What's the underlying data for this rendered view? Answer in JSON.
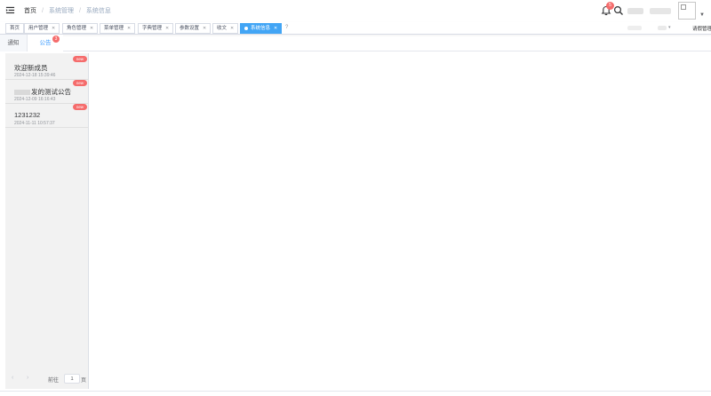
{
  "navbar": {
    "breadcrumb": [
      "首页",
      "系统管理",
      "系统信息"
    ],
    "notification_count": "5"
  },
  "tags": [
    {
      "label": "首页",
      "closable": false
    },
    {
      "label": "用户管理",
      "closable": true
    },
    {
      "label": "角色管理",
      "closable": true
    },
    {
      "label": "菜单管理",
      "closable": true
    },
    {
      "label": "字典管理",
      "closable": true
    },
    {
      "label": "参数设置",
      "closable": true
    },
    {
      "label": "收文",
      "closable": true
    },
    {
      "label": "系统信息",
      "closable": true,
      "active": true
    }
  ],
  "tags_extra": {
    "question": "?",
    "last_label": "请假管理"
  },
  "tabs": {
    "notice": "通知",
    "announcement": "公告",
    "announcement_badge": "3"
  },
  "announcements": [
    {
      "title": "欢迎新成员",
      "time": "2024-12-18 15:39:46",
      "badge": "new"
    },
    {
      "title": "发的测试公告",
      "time": "2024-12-09 16:16:43",
      "badge": "new"
    },
    {
      "title": "1231232",
      "time": "2024-11-11 10:57:37",
      "badge": "new"
    }
  ],
  "pagination": {
    "goto_label": "前往",
    "page_value": "1",
    "page_suffix": "页"
  },
  "colors": {
    "accent": "#409eff",
    "active_tag": "#42a5f5",
    "badge_red": "#f56c6c"
  },
  "icons": [
    "hamburger-icon",
    "bell-icon",
    "search-icon",
    "broken-image-icon",
    "caret-down-icon",
    "close-icon",
    "chevron-left-icon",
    "chevron-right-icon"
  ]
}
